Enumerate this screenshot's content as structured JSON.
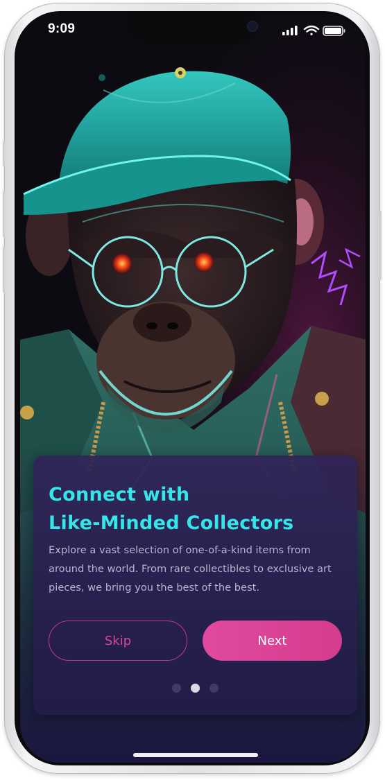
{
  "status_bar": {
    "time": "9:09",
    "icons": [
      "cellular-signal-icon",
      "wifi-icon",
      "battery-icon"
    ]
  },
  "hero": {
    "subject": "monkey-illustration"
  },
  "onboarding": {
    "title_line1": "Connect with",
    "title_line2": "Like-Minded Collectors",
    "description": "Explore a vast selection of one-of-a-kind items from around the world. From rare collectibles to exclusive art pieces, we bring you the best of the best.",
    "skip_label": "Skip",
    "next_label": "Next",
    "page_total": 3,
    "page_current": 2
  },
  "colors": {
    "accent_cyan": "#34e6e9",
    "accent_pink": "#e04aa0",
    "card_bg": "#2e2458",
    "text_secondary": "#b9b4cf"
  }
}
